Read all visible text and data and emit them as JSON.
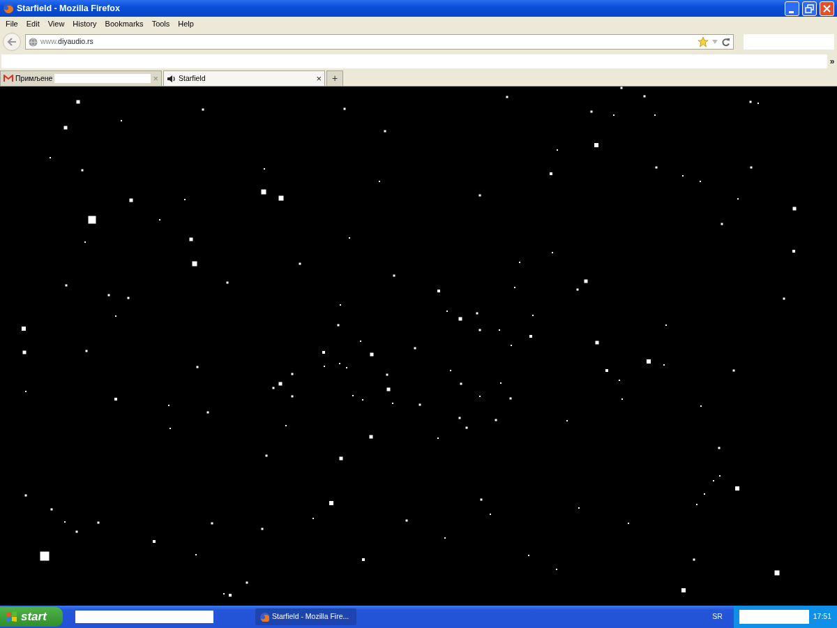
{
  "window": {
    "title": "Starfield - Mozilla Firefox"
  },
  "menu": [
    "File",
    "Edit",
    "View",
    "History",
    "Bookmarks",
    "Tools",
    "Help"
  ],
  "address_bar": {
    "prefix": "www.",
    "domain": "diyaudio.rs"
  },
  "bookmarks_overflow": "»",
  "tabs": [
    {
      "label": "Примљене",
      "close": "×",
      "selected": false
    },
    {
      "label": "Starfield",
      "close": "×",
      "selected": true
    }
  ],
  "new_tab": "+",
  "taskbar": {
    "start": "start",
    "tasks": [
      {
        "label": "Starfield - Mozilla Fire...",
        "selected": true
      }
    ],
    "language": "SR",
    "clock": "17:51"
  }
}
